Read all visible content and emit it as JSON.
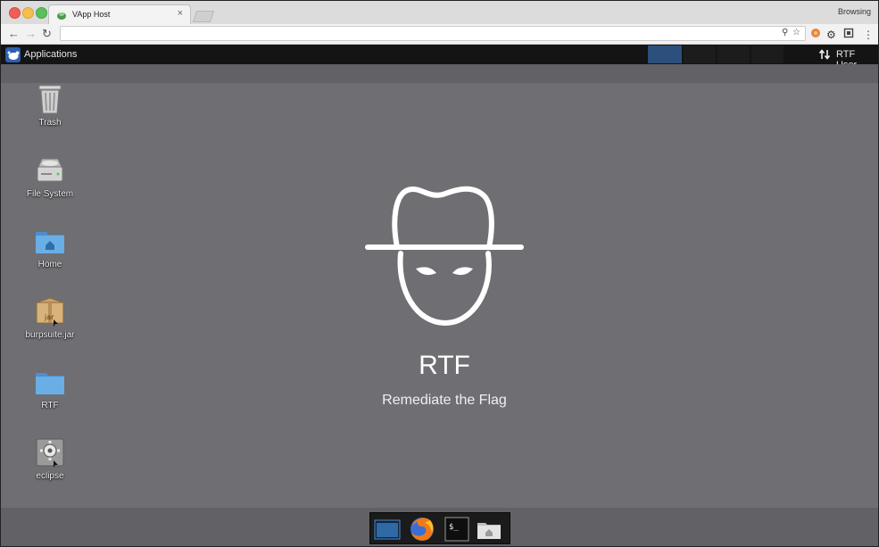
{
  "browser": {
    "tab_title": "VApp Host",
    "tab_close": "×",
    "profile_label": "Browsing",
    "url": "",
    "icons": {
      "back": "arrow-left-icon",
      "forward": "arrow-right-icon",
      "reload": "reload-icon",
      "key": "key-icon",
      "bookmark": "star-icon",
      "extension": "extension-icon",
      "settings": "gear-icon",
      "cast": "cast-icon",
      "menu": "kebab-menu-icon"
    }
  },
  "panel": {
    "applications_label": "Applications",
    "user_label": "RTF User"
  },
  "desktop": {
    "icons": [
      {
        "name": "trash",
        "label": "Trash",
        "icon": "trash-icon"
      },
      {
        "name": "file-system",
        "label": "File System",
        "icon": "hard-drive-icon"
      },
      {
        "name": "home",
        "label": "Home",
        "icon": "home-folder-icon"
      },
      {
        "name": "burpsuite",
        "label": "burpsuite.jar",
        "icon": "jar-package-icon"
      },
      {
        "name": "rtf",
        "label": "RTF",
        "icon": "folder-icon"
      },
      {
        "name": "eclipse",
        "label": "eclipse",
        "icon": "gear-executable-icon"
      }
    ],
    "brand": "RTF",
    "tagline": "Remediate the Flag"
  },
  "dock": {
    "items": [
      "show-desktop-icon",
      "firefox-icon",
      "terminal-icon",
      "home-folder-icon"
    ]
  },
  "colors": {
    "desktop_bg": "#6f6e73",
    "panel_bg": "#141414",
    "workspace_active": "#2c4f7c"
  }
}
